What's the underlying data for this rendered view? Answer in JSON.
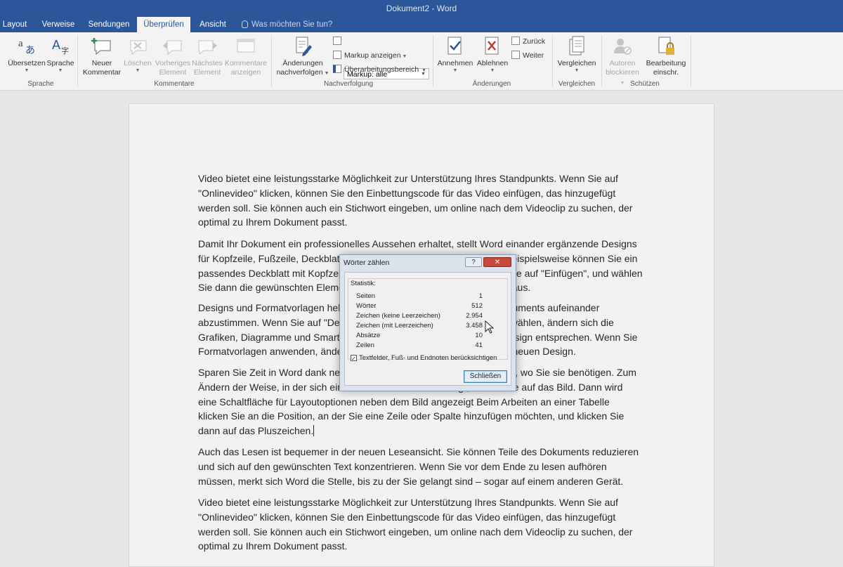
{
  "window": {
    "title": "Dokument2 - Word"
  },
  "tabs": [
    {
      "label": "Layout",
      "active": false
    },
    {
      "label": "Verweise",
      "active": false
    },
    {
      "label": "Sendungen",
      "active": false
    },
    {
      "label": "Überprüfen",
      "active": true
    },
    {
      "label": "Ansicht",
      "active": false
    }
  ],
  "tell_me": {
    "placeholder": "Was möchten Sie tun?"
  },
  "ribbon": {
    "sprache": {
      "label": "Sprache",
      "uebersetzen": "Übersetzen",
      "sprache": "Sprache"
    },
    "kommentare": {
      "label": "Kommentare",
      "neuer_l1": "Neuer",
      "neuer_l2": "Kommentar",
      "loeschen": "Löschen",
      "vorheriges_l1": "Vorheriges",
      "vorheriges_l2": "Element",
      "naechstes_l1": "Nächstes",
      "naechstes_l2": "Element",
      "anzeigen_l1": "Kommentare",
      "anzeigen_l2": "anzeigen"
    },
    "nachverfolgung": {
      "label": "Nachverfolgung",
      "aenderungen_l1": "Änderungen",
      "aenderungen_l2": "nachverfolgen",
      "markup_value": "Markup: alle",
      "markup_anzeigen": "Markup anzeigen",
      "ueberarbeitungsbereich": "Überarbeitungsbereich"
    },
    "aenderungen": {
      "label": "Änderungen",
      "annehmen": "Annehmen",
      "ablehnen": "Ablehnen",
      "zurueck": "Zurück",
      "weiter": "Weiter"
    },
    "vergleichen": {
      "label": "Vergleichen",
      "button": "Vergleichen"
    },
    "schuetzen": {
      "label": "Schützen",
      "autoren_l1": "Autoren",
      "autoren_l2": "blockieren",
      "bearbeitung_l1": "Bearbeitung",
      "bearbeitung_l2": "einschr."
    }
  },
  "document": {
    "p1": [
      "Video bietet eine leistungsstarke Möglichkeit zur Unterstützung Ihres Standpunkts. Wenn Sie auf",
      "\"Onlinevideo\" klicken, können Sie den Einbettungscode für das Video einfügen, das hinzugefügt",
      "werden soll. Sie können auch ein Stichwort eingeben, um online nach dem Videoclip zu suchen, der",
      "optimal zu Ihrem Dokument passt."
    ],
    "p2": [
      "Damit Ihr Dokument ein professionelles Aussehen erhaltet, stellt Word einander ergänzende Designs",
      "für Kopfzeile, Fußzeile, Deckblatt und Textfeldentwürfe zur Verfügung. Beispielsweise können Sie ein",
      "passendes Deckblatt mit Kopfzeile und Randleiste hinzufügen. Klicken Sie auf \"Einfügen\", und wählen",
      "Sie dann die gewünschten Elemente aus den verschiedenen Katalogen aus."
    ],
    "p3": [
      "Designs und Formatvorlagen helfen auch dabei, die Elemente Ihres Dokuments aufeinander",
      "abzustimmen. Wenn Sie auf \"Design\" klicken und ein neues Design auswählen, ändern sich die",
      "Grafiken, Diagramme und SmartArt-Grafiken so, dass sie dem neuen Design entsprechen. Wenn Sie",
      "Formatvorlagen anwenden, ändern sich die Überschriften passend zum neuen Design."
    ],
    "p4": [
      "Sparen Sie Zeit in Word dank neuer Schaltflächen, die angezeigt werden, wo Sie sie benötigen. Zum",
      "Ändern der Weise, in der sich ein Bild in Ihr Dokument einfügt, klicken Sie auf das Bild. Dann wird",
      "eine Schaltfläche für Layoutoptionen neben dem Bild angezeigt Beim Arbeiten an einer Tabelle",
      "klicken Sie an die Position, an der Sie eine Zeile oder Spalte hinzufügen möchten, und klicken Sie",
      "dann auf das Pluszeichen."
    ],
    "p5": [
      "Auch das Lesen ist bequemer in der neuen Leseansicht. Sie können Teile des Dokuments reduzieren",
      "und sich auf den gewünschten Text konzentrieren. Wenn Sie vor dem Ende zu lesen aufhören",
      "müssen, merkt sich Word die Stelle, bis zu der Sie gelangt sind – sogar auf einem anderen Gerät."
    ],
    "p6": [
      "Video bietet eine leistungsstarke Möglichkeit zur Unterstützung Ihres Standpunkts. Wenn Sie auf",
      "\"Onlinevideo\" klicken, können Sie den Einbettungscode für das Video einfügen, das hinzugefügt",
      "werden soll. Sie können auch ein Stichwort eingeben, um online nach dem Videoclip zu suchen, der",
      "optimal zu Ihrem Dokument passt."
    ]
  },
  "dialog": {
    "title": "Wörter zählen",
    "help": "?",
    "section": "Statistik:",
    "rows": [
      {
        "label": "Seiten",
        "value": "1"
      },
      {
        "label": "Wörter",
        "value": "512"
      },
      {
        "label": "Zeichen (keine Leerzeichen)",
        "value": "2.954"
      },
      {
        "label": "Zeichen (mit Leerzeichen)",
        "value": "3.458"
      },
      {
        "label": "Absätze",
        "value": "10"
      },
      {
        "label": "Zeilen",
        "value": "41"
      }
    ],
    "checkbox_label": "Textfelder, Fuß- und Endnoten berücksichtigen",
    "checkbox_checked": true,
    "close_button": "Schließen"
  },
  "colors": {
    "title_bar": "#2b579a",
    "ribbon": "#f3f3f3",
    "page": "#f2f2f2"
  }
}
